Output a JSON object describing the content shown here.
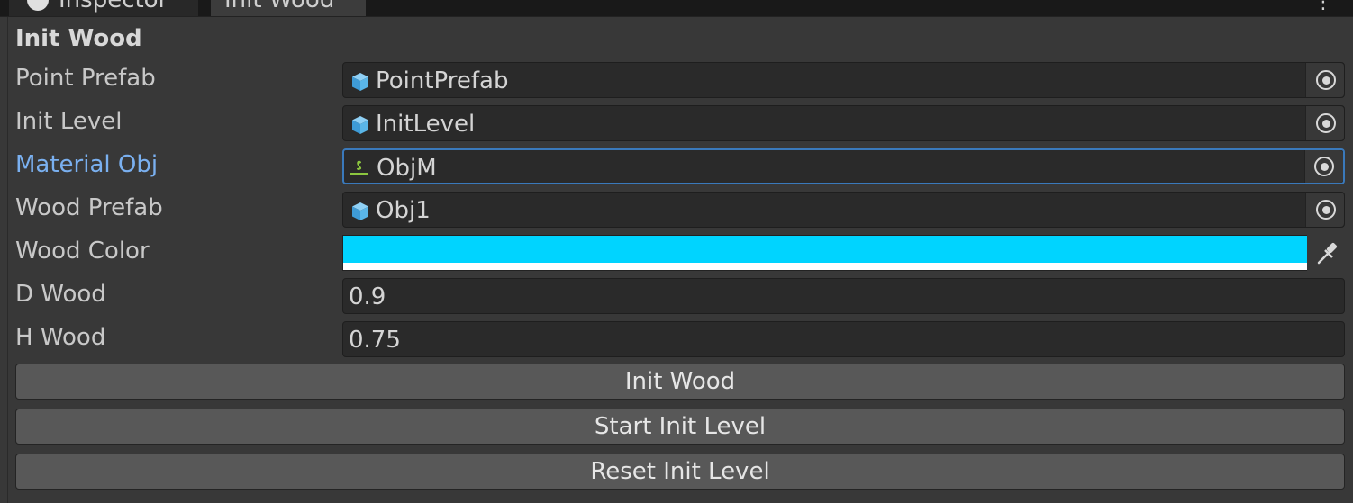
{
  "tabs": {
    "inspector_label": "Inspector",
    "active_label": "Init Wood",
    "menu_glyph": "⋮"
  },
  "component": {
    "title": "Init Wood"
  },
  "fields": {
    "point_prefab": {
      "label": "Point Prefab",
      "value": "PointPrefab",
      "icon": "prefab-cube-icon"
    },
    "init_level": {
      "label": "Init Level",
      "value": "InitLevel",
      "icon": "prefab-cube-icon"
    },
    "material_obj": {
      "label": "Material Obj",
      "value": "ObjM",
      "icon": "material-asset-icon"
    },
    "wood_prefab": {
      "label": "Wood Prefab",
      "value": "Obj1",
      "icon": "prefab-cube-icon"
    },
    "wood_color": {
      "label": "Wood Color",
      "color": "#00D4FF",
      "alpha": 1.0
    },
    "d_wood": {
      "label": "D Wood",
      "value": "0.9"
    },
    "h_wood": {
      "label": "H Wood",
      "value": "0.75"
    }
  },
  "buttons": {
    "init_wood": "Init Wood",
    "start_init_level": "Start Init Level",
    "reset_init_level": "Reset Init Level"
  },
  "colors": {
    "background": "#383838",
    "field_bg": "#2a2a2a",
    "highlight_label": "#7ab0f0",
    "focus_border": "#3a79bb",
    "prefab_icon": "#5ab6e8",
    "button_bg": "#585858"
  }
}
